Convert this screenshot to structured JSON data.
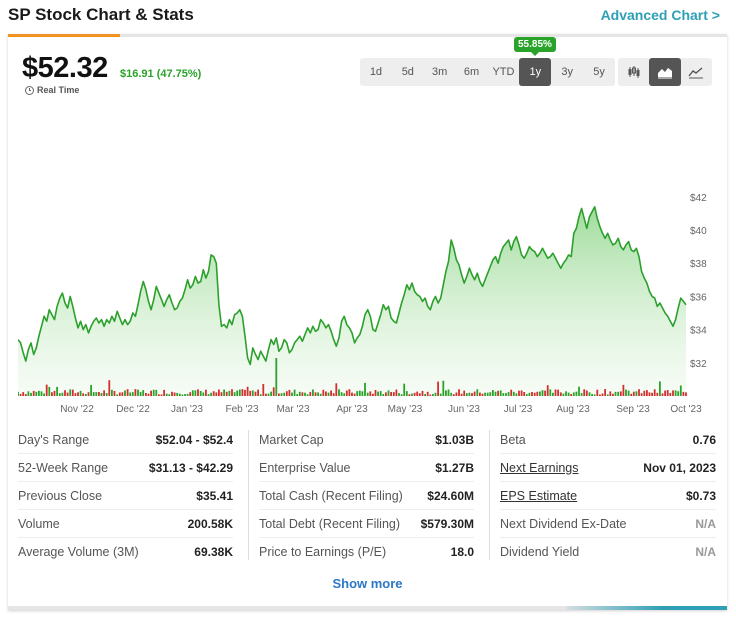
{
  "header": {
    "title": "SP Stock Chart & Stats",
    "advanced_link": "Advanced Chart >"
  },
  "quote": {
    "price": "$52.32",
    "change": "$16.91 (47.75%)",
    "realtime_label": "Real Time"
  },
  "range_tabs": [
    {
      "label": "1d",
      "active": false
    },
    {
      "label": "5d",
      "active": false
    },
    {
      "label": "3m",
      "active": false
    },
    {
      "label": "6m",
      "active": false
    },
    {
      "label": "YTD",
      "active": false
    },
    {
      "label": "1y",
      "active": true
    },
    {
      "label": "3y",
      "active": false
    },
    {
      "label": "5y",
      "active": false
    }
  ],
  "return_badge": "55.85%",
  "chart_types": [
    {
      "icon": "candlestick-icon",
      "active": false
    },
    {
      "icon": "area-chart-icon",
      "active": true
    },
    {
      "icon": "line-chart-icon",
      "active": false
    }
  ],
  "colors": {
    "up": "#29a329",
    "down": "#d32f2f",
    "line": "#2ca02c",
    "accent": "#f39322",
    "link": "#2b78c5",
    "teal": "#2e9fb5"
  },
  "chart_data": {
    "type": "area",
    "x_ticks": [
      "Nov '22",
      "Dec '22",
      "Jan '23",
      "Feb '23",
      "Mar '23",
      "Apr '23",
      "May '23",
      "Jun '23",
      "Jul '23",
      "Aug '23",
      "Sep '23",
      "Oct '23"
    ],
    "y_ticks": [
      "$42",
      "$40",
      "$38",
      "$36",
      "$34",
      "$32"
    ],
    "ylim": [
      30,
      43
    ],
    "series": [
      {
        "values": [
          33.4,
          33.2,
          32.6,
          32.1,
          32.8,
          33.2,
          32.5,
          32.9,
          33.6,
          34.2,
          34.8,
          34.5,
          35.2,
          34.9,
          34.6,
          35.4,
          35.9,
          36.2,
          35.6,
          35.3,
          36.0,
          35.4,
          34.7,
          34.1,
          34.5,
          34.0,
          34.3,
          33.8,
          34.2,
          34.5,
          34.7,
          34.4,
          34.6,
          34.2,
          34.6,
          34.4,
          34.8,
          34.5,
          35.1,
          34.7,
          34.3,
          34.6,
          34.3,
          34.5,
          35.0,
          34.8,
          35.5,
          36.3,
          36.9,
          36.4,
          35.7,
          35.2,
          35.8,
          36.6,
          36.2,
          35.8,
          35.4,
          35.8,
          36.1,
          35.6,
          35.2,
          35.3,
          35.7,
          35.9,
          36.4,
          37.0,
          36.5,
          36.7,
          37.2,
          36.8,
          36.9,
          37.6,
          37.1,
          37.5,
          38.5,
          38.4,
          38.0,
          35.5,
          34.2,
          34.3,
          34.1,
          34.6,
          34.3,
          34.9,
          35.0,
          35.2,
          34.8,
          33.6,
          32.3,
          31.9,
          32.9,
          32.5,
          32.2,
          32.7,
          32.4,
          32.1,
          32.8,
          33.4,
          33.1,
          33.5,
          32.7,
          32.9,
          33.4,
          33.2,
          32.6,
          32.8,
          33.2,
          33.4,
          33.6,
          33.3,
          33.7,
          34.1,
          33.8,
          34.2,
          33.9,
          34.0,
          34.6,
          34.4,
          34.1,
          34.3,
          33.9,
          33.4,
          33.0,
          33.5,
          34.5,
          34.8,
          34.3,
          34.1,
          33.8,
          33.2,
          33.5,
          33.7,
          34.2,
          34.9,
          35.2,
          34.8,
          34.0,
          33.9,
          34.4,
          34.9,
          35.5,
          35.2,
          35.4,
          34.7,
          34.5,
          34.4,
          35.0,
          35.6,
          36.1,
          36.7,
          36.4,
          36.8,
          36.3,
          36.1,
          36.0,
          35.7,
          35.9,
          35.4,
          35.2,
          35.7,
          36.0,
          35.6,
          35.9,
          36.7,
          37.5,
          38.1,
          39.4,
          38.9,
          38.2,
          37.9,
          37.3,
          36.8,
          37.2,
          37.7,
          37.3,
          37.0,
          37.4,
          36.9,
          36.6,
          37.0,
          37.4,
          37.8,
          38.2,
          38.4,
          38.0,
          38.6,
          39.0,
          39.2,
          39.4,
          38.8,
          39.3,
          39.6,
          39.1,
          38.5,
          38.3,
          38.6,
          39.0,
          38.8,
          38.7,
          38.4,
          38.6,
          38.9,
          38.6,
          38.3,
          38.4,
          38.6,
          38.3,
          38.0,
          37.7,
          38.0,
          38.2,
          38.5,
          38.4,
          39.8,
          40.1,
          40.8,
          41.3,
          40.7,
          40.1,
          40.8,
          41.1,
          41.4,
          40.7,
          40.2,
          39.8,
          39.5,
          39.8,
          39.4,
          39.1,
          39.2,
          39.5,
          39.0,
          38.8,
          39.1,
          39.3,
          38.8,
          38.7,
          38.9,
          38.4,
          37.5,
          37.1,
          36.8,
          36.3,
          36.0,
          35.9,
          35.4,
          35.6,
          35.3,
          35.0,
          34.8,
          34.5,
          34.2,
          34.6,
          35.3,
          35.9,
          35.7,
          35.5
        ]
      },
      {
        "name": "Volume"
      }
    ]
  },
  "stats": {
    "col1": [
      {
        "label": "Day's Range",
        "value": "$52.04 - $52.4"
      },
      {
        "label": "52-Week Range",
        "value": "$31.13 - $42.29"
      },
      {
        "label": "Previous Close",
        "value": "$35.41"
      },
      {
        "label": "Volume",
        "value": "200.58K"
      },
      {
        "label": "Average Volume (3M)",
        "value": "69.38K"
      }
    ],
    "col2": [
      {
        "label": "Market Cap",
        "value": "$1.03B"
      },
      {
        "label": "Enterprise Value",
        "value": "$1.27B"
      },
      {
        "label": "Total Cash (Recent Filing)",
        "value": "$24.60M"
      },
      {
        "label": "Total Debt (Recent Filing)",
        "value": "$579.30M"
      },
      {
        "label": "Price to Earnings (P/E)",
        "value": "18.0"
      }
    ],
    "col3": [
      {
        "label": "Beta",
        "value": "0.76"
      },
      {
        "label": "Next Earnings",
        "value": "Nov 01, 2023"
      },
      {
        "label": "EPS Estimate",
        "value": "$0.73"
      },
      {
        "label": "Next Dividend Ex-Date",
        "value": "N/A"
      },
      {
        "label": "Dividend Yield",
        "value": "N/A"
      }
    ]
  },
  "show_more": "Show more"
}
